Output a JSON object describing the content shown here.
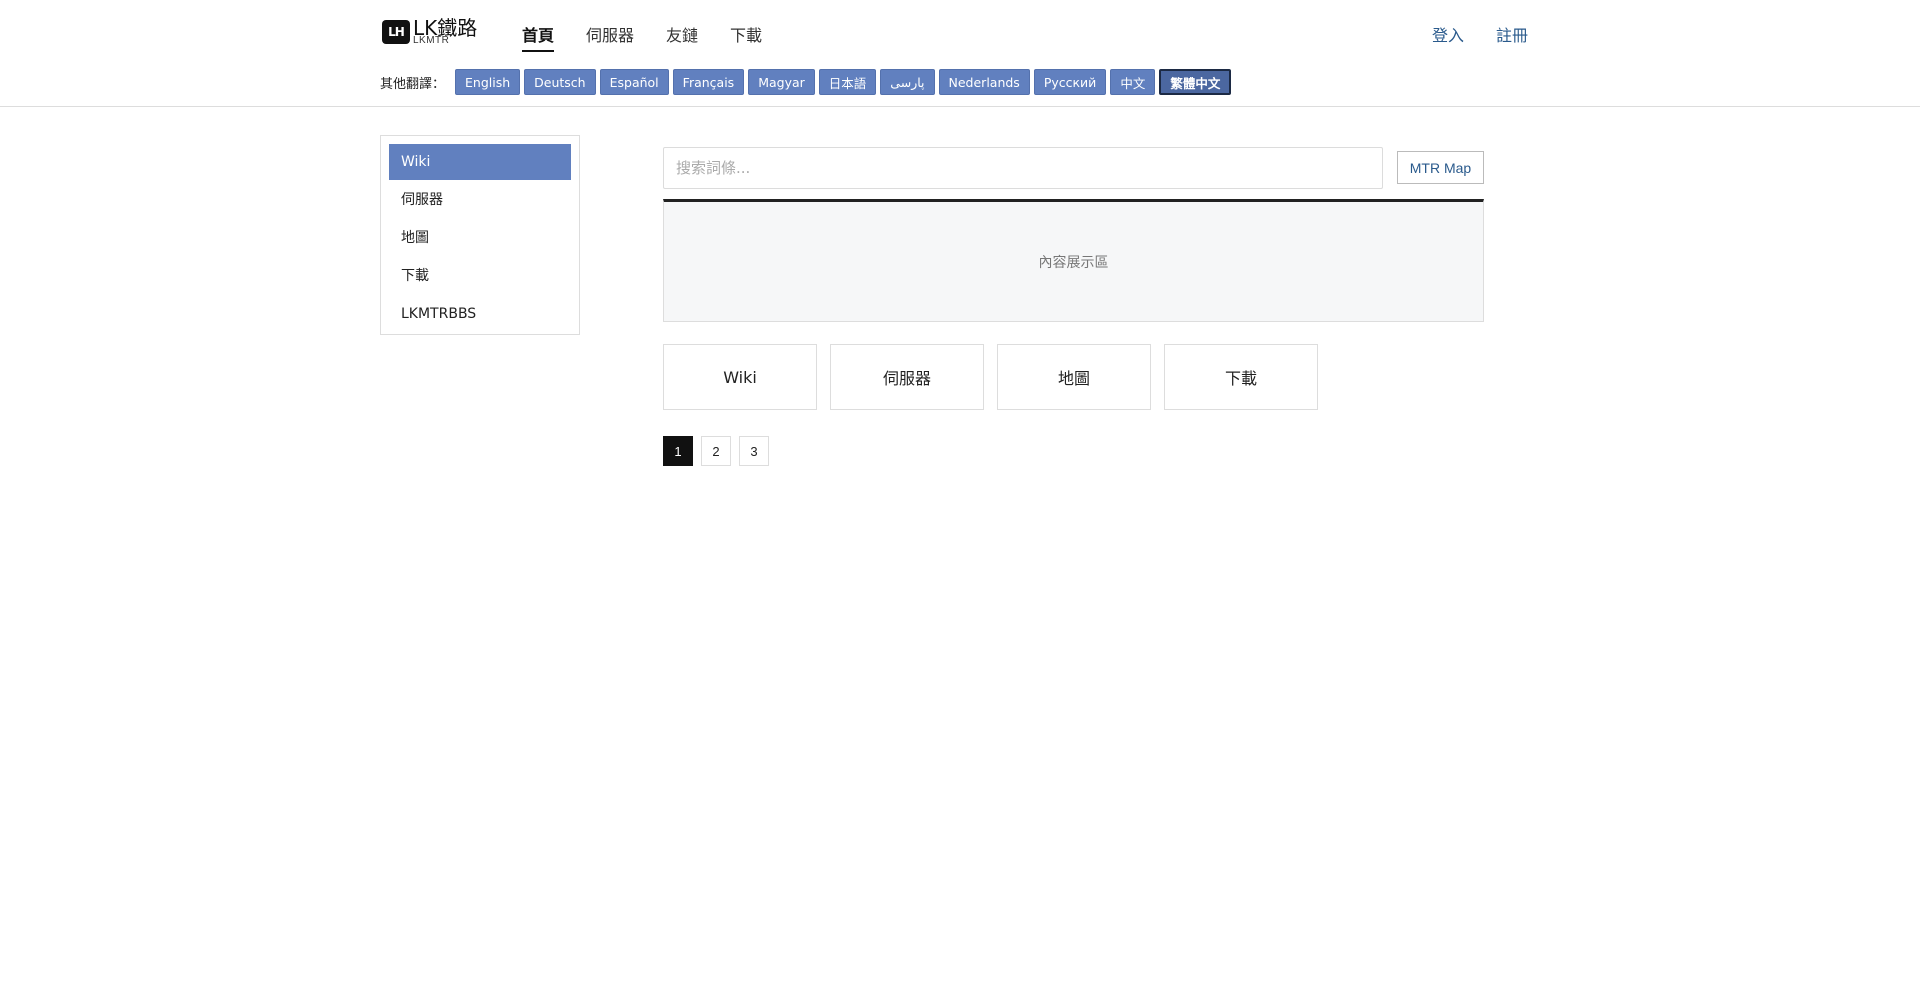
{
  "header": {
    "logo": {
      "mark": "LH",
      "title": "LK鐵路",
      "subtitle": "LKMTR"
    },
    "nav": [
      {
        "label": "首頁",
        "active": true
      },
      {
        "label": "伺服器",
        "active": false
      },
      {
        "label": "友鏈",
        "active": false
      },
      {
        "label": "下載",
        "active": false
      }
    ],
    "auth": {
      "login": "登入",
      "register": "註冊"
    },
    "languages": {
      "label": "其他翻譯：",
      "items": [
        {
          "label": "English"
        },
        {
          "label": "Deutsch"
        },
        {
          "label": "Español"
        },
        {
          "label": "Français"
        },
        {
          "label": "Magyar"
        },
        {
          "label": "日本語"
        },
        {
          "label": "پارسی"
        },
        {
          "label": "Nederlands"
        },
        {
          "label": "Русский"
        },
        {
          "label": "中文"
        },
        {
          "label": "繁體中文"
        }
      ],
      "active": "繁體中文"
    }
  },
  "sidebar": {
    "items": [
      {
        "label": "Wiki"
      },
      {
        "label": "伺服器"
      },
      {
        "label": "地圖"
      },
      {
        "label": "下載"
      },
      {
        "label": "LKMTRBBS"
      }
    ],
    "active": "Wiki"
  },
  "main": {
    "search": {
      "placeholder": "搜索詞條...",
      "value": ""
    },
    "map_button": "MTR Map",
    "content_placeholder": "內容展示區",
    "cards": [
      {
        "label": "Wiki"
      },
      {
        "label": "伺服器"
      },
      {
        "label": "地圖"
      },
      {
        "label": "下載"
      }
    ],
    "pagination": {
      "pages": [
        "1",
        "2",
        "3"
      ],
      "current": "1"
    }
  },
  "colors": {
    "accent": "#6180bf",
    "link": "#2a5a8c",
    "dark": "#111111"
  }
}
